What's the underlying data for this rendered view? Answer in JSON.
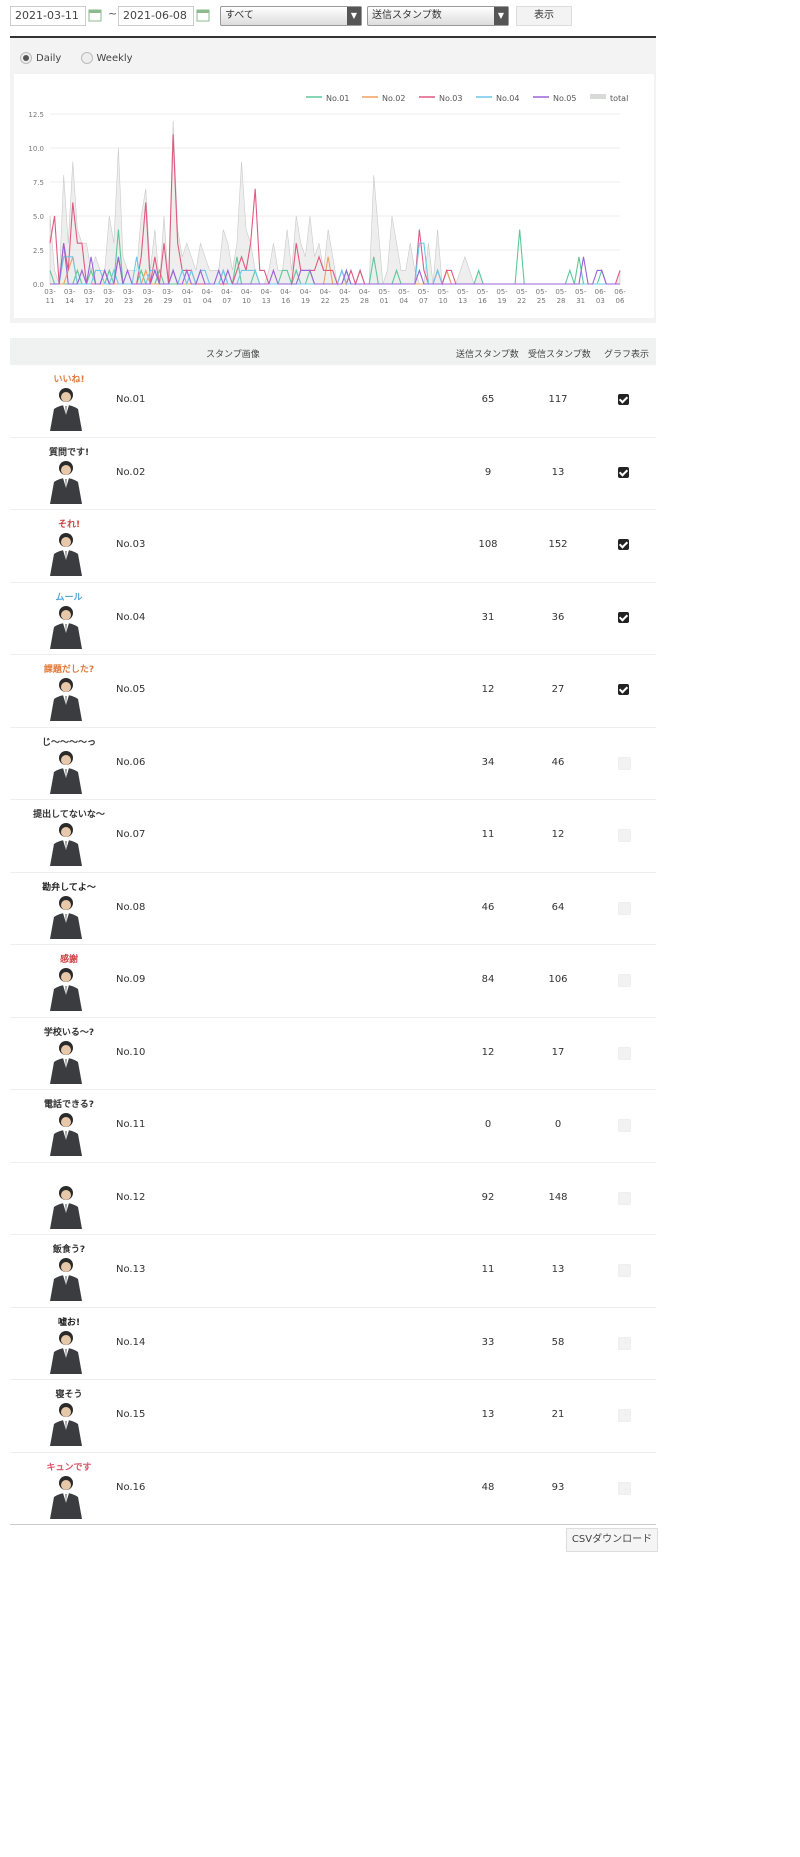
{
  "filter": {
    "start_date": "2021-03-11",
    "separator": "~",
    "end_date": "2021-06-08",
    "category_select": "すべて",
    "metric_select": "送信スタンプ数",
    "show_button": "表示"
  },
  "period": {
    "daily": "Daily",
    "weekly": "Weekly",
    "selected": "Daily"
  },
  "chart_data": {
    "type": "area",
    "title": "",
    "xlabel": "",
    "ylabel": "",
    "ylim": [
      0,
      12.5
    ],
    "yticks": [
      "0.0",
      "2.5",
      "5.0",
      "7.5",
      "10.0",
      "12.5"
    ],
    "tick_labels": [
      [
        "03-",
        "11"
      ],
      [
        "03-",
        "14"
      ],
      [
        "03-",
        "17"
      ],
      [
        "03-",
        "20"
      ],
      [
        "03-",
        "23"
      ],
      [
        "03-",
        "26"
      ],
      [
        "03-",
        "29"
      ],
      [
        "04-",
        "01"
      ],
      [
        "04-",
        "04"
      ],
      [
        "04-",
        "07"
      ],
      [
        "04-",
        "10"
      ],
      [
        "04-",
        "13"
      ],
      [
        "04-",
        "16"
      ],
      [
        "04-",
        "19"
      ],
      [
        "04-",
        "22"
      ],
      [
        "04-",
        "25"
      ],
      [
        "04-",
        "28"
      ],
      [
        "05-",
        "01"
      ],
      [
        "05-",
        "04"
      ],
      [
        "05-",
        "07"
      ],
      [
        "05-",
        "10"
      ],
      [
        "05-",
        "13"
      ],
      [
        "05-",
        "16"
      ],
      [
        "05-",
        "19"
      ],
      [
        "05-",
        "22"
      ],
      [
        "05-",
        "25"
      ],
      [
        "05-",
        "28"
      ],
      [
        "05-",
        "31"
      ],
      [
        "06-",
        "03"
      ],
      [
        "06-",
        "06"
      ]
    ],
    "legend_position": "top-right",
    "series": [
      {
        "name": "No.01",
        "color": "#5ec79a",
        "values": [
          1,
          0,
          0,
          0,
          0,
          0,
          1,
          0,
          0,
          1,
          0,
          0,
          0,
          1,
          0,
          4,
          0,
          0,
          0,
          0,
          1,
          0,
          0,
          0,
          1,
          0,
          0,
          0,
          0,
          0,
          0,
          0,
          0,
          0,
          0,
          0,
          0,
          0,
          1,
          0,
          0,
          2,
          0,
          0,
          0,
          1,
          0,
          0,
          0,
          0,
          0,
          1,
          1,
          0,
          1,
          0,
          0,
          1,
          0,
          0,
          0,
          0,
          0,
          0,
          0,
          1,
          0,
          0,
          1,
          0,
          0,
          2,
          0,
          0,
          0,
          0,
          1,
          0,
          0,
          0,
          0,
          0,
          0,
          0,
          0,
          0,
          0,
          1,
          0,
          0,
          0,
          0,
          0,
          0,
          1,
          0,
          0,
          0,
          0,
          0,
          0,
          0,
          0,
          4,
          0,
          0,
          0,
          0,
          0,
          0,
          0,
          0,
          0,
          0,
          1,
          0,
          2,
          0,
          0,
          0,
          0,
          1,
          0,
          0,
          0,
          0
        ]
      },
      {
        "name": "No.02",
        "color": "#f0a060",
        "values": [
          0,
          0,
          0,
          0,
          1,
          2,
          0,
          0,
          0,
          0,
          0,
          0,
          0,
          0,
          0,
          0,
          0,
          0,
          0,
          0,
          0,
          1,
          0,
          0,
          0,
          0,
          0,
          1,
          0,
          0,
          0,
          0,
          0,
          0,
          0,
          0,
          0,
          0,
          0,
          0,
          0,
          0,
          0,
          0,
          0,
          0,
          0,
          0,
          0,
          0,
          0,
          0,
          0,
          0,
          0,
          0,
          0,
          0,
          0,
          0,
          0,
          2,
          0,
          0,
          0,
          0,
          0,
          0,
          0,
          0,
          0,
          0,
          0,
          0,
          0,
          0,
          0,
          0,
          0,
          0,
          0,
          0,
          0,
          0,
          0,
          0,
          0,
          1,
          0,
          0,
          0,
          0,
          0,
          0,
          0,
          0,
          0,
          0,
          0,
          0,
          0,
          0,
          0,
          0,
          0,
          0,
          0,
          0,
          0,
          0,
          0,
          0,
          0,
          0,
          0,
          0,
          0,
          0,
          0,
          0,
          0,
          0,
          0,
          0,
          0,
          0
        ]
      },
      {
        "name": "No.03",
        "color": "#e05a82",
        "values": [
          3,
          5,
          0,
          3,
          1,
          6,
          3,
          3,
          0,
          0,
          0,
          0,
          1,
          0,
          0,
          2,
          0,
          0,
          0,
          0,
          2,
          6,
          0,
          2,
          0,
          3,
          0,
          11,
          3,
          1,
          1,
          1,
          0,
          0,
          0,
          0,
          0,
          0,
          0,
          0,
          0,
          1,
          2,
          1,
          3,
          7,
          1,
          1,
          0,
          0,
          0,
          0,
          0,
          0,
          3,
          1,
          1,
          1,
          1,
          2,
          1,
          1,
          1,
          0,
          1,
          0,
          1,
          0,
          1,
          0,
          0,
          0,
          0,
          0,
          0,
          0,
          0,
          0,
          0,
          0,
          0,
          4,
          1,
          0,
          0,
          1,
          0,
          1,
          1,
          0,
          0,
          0,
          0,
          0,
          0,
          0,
          0,
          0,
          0,
          0,
          0,
          0,
          0,
          0,
          0,
          0,
          0,
          0,
          0,
          0,
          0,
          0,
          0,
          0,
          0,
          0,
          0,
          0,
          0,
          0,
          0,
          0,
          0,
          0,
          0,
          1
        ]
      },
      {
        "name": "No.04",
        "color": "#6cc8e8",
        "values": [
          0,
          0,
          0,
          2,
          2,
          2,
          0,
          0,
          0,
          0,
          1,
          1,
          0,
          0,
          1,
          0,
          0,
          0,
          0,
          2,
          0,
          0,
          1,
          1,
          0,
          0,
          0,
          1,
          0,
          1,
          0,
          1,
          0,
          1,
          1,
          0,
          0,
          0,
          1,
          0,
          0,
          0,
          1,
          1,
          1,
          1,
          0,
          0,
          0,
          0,
          0,
          0,
          0,
          0,
          0,
          0,
          0,
          0,
          0,
          0,
          0,
          0,
          0,
          0,
          1,
          0,
          0,
          0,
          0,
          0,
          0,
          0,
          0,
          0,
          0,
          0,
          0,
          0,
          0,
          0,
          0,
          3,
          3,
          0,
          0,
          1,
          0,
          0,
          0,
          0,
          0,
          0,
          0,
          0,
          0,
          0,
          0,
          0,
          0,
          0,
          0,
          0,
          0,
          0,
          0,
          0,
          0,
          0,
          0,
          0,
          0,
          0,
          0,
          0,
          0,
          0,
          0,
          0,
          0,
          0,
          0,
          0,
          0,
          0,
          0,
          0
        ]
      },
      {
        "name": "No.05",
        "color": "#9a63d9",
        "values": [
          0,
          0,
          0,
          3,
          0,
          0,
          0,
          1,
          0,
          2,
          0,
          0,
          1,
          0,
          0,
          2,
          0,
          1,
          0,
          0,
          0,
          0,
          0,
          1,
          0,
          0,
          0,
          1,
          0,
          0,
          1,
          0,
          0,
          1,
          0,
          0,
          0,
          1,
          0,
          1,
          0,
          0,
          0,
          0,
          0,
          0,
          0,
          0,
          0,
          1,
          0,
          0,
          0,
          0,
          0,
          1,
          1,
          1,
          0,
          0,
          0,
          0,
          0,
          0,
          0,
          1,
          0,
          0,
          0,
          0,
          0,
          0,
          0,
          0,
          0,
          0,
          0,
          0,
          0,
          0,
          0,
          1,
          0,
          0,
          0,
          0,
          0,
          0,
          0,
          0,
          0,
          0,
          0,
          0,
          0,
          0,
          0,
          0,
          0,
          0,
          0,
          0,
          0,
          0,
          0,
          0,
          0,
          0,
          0,
          0,
          0,
          0,
          0,
          0,
          0,
          0,
          0,
          2,
          0,
          0,
          1,
          1,
          0,
          0,
          0,
          0
        ]
      },
      {
        "name": "total",
        "color": "#d8dad8",
        "values": [
          5,
          1,
          0,
          8,
          3,
          9,
          4,
          3,
          3,
          1,
          2,
          1,
          1,
          5,
          3,
          10,
          2,
          1,
          1,
          1,
          5,
          7,
          1,
          4,
          0,
          5,
          0,
          12,
          4,
          2,
          3,
          2,
          1,
          3,
          2,
          1,
          1,
          1,
          4,
          3,
          1,
          3,
          9,
          4,
          3,
          1,
          0,
          0,
          1,
          3,
          1,
          1,
          4,
          1,
          5,
          3,
          2,
          5,
          2,
          3,
          1,
          4,
          2,
          0,
          0,
          1,
          0,
          0,
          0,
          0,
          0,
          8,
          4,
          0,
          1,
          5,
          3,
          1,
          1,
          3,
          1,
          0,
          0,
          3,
          0,
          4,
          0,
          0,
          0,
          0,
          1,
          2,
          1,
          0,
          1,
          0,
          0,
          0,
          0,
          0,
          0,
          0,
          0,
          0,
          0,
          0,
          0,
          0,
          0,
          0,
          0,
          0,
          0,
          0,
          0,
          0,
          0,
          0,
          0,
          0,
          0,
          0,
          0,
          0,
          0,
          1
        ]
      }
    ]
  },
  "table": {
    "headers": {
      "image": "スタンプ画像",
      "sent": "送信スタンプ数",
      "received": "受信スタンプ数",
      "graph": "グラフ表示"
    },
    "rows": [
      {
        "name": "No.01",
        "sent": "65",
        "received": "117",
        "checked": true,
        "caption": "いいね!"
      },
      {
        "name": "No.02",
        "sent": "9",
        "received": "13",
        "checked": true,
        "caption": "質問です!"
      },
      {
        "name": "No.03",
        "sent": "108",
        "received": "152",
        "checked": true,
        "caption": "それ!"
      },
      {
        "name": "No.04",
        "sent": "31",
        "received": "36",
        "checked": true,
        "caption": "ムール"
      },
      {
        "name": "No.05",
        "sent": "12",
        "received": "27",
        "checked": true,
        "caption": "課題だした?"
      },
      {
        "name": "No.06",
        "sent": "34",
        "received": "46",
        "checked": false,
        "caption": "じ〜〜〜〜っ"
      },
      {
        "name": "No.07",
        "sent": "11",
        "received": "12",
        "checked": false,
        "caption": "提出してないな〜"
      },
      {
        "name": "No.08",
        "sent": "46",
        "received": "64",
        "checked": false,
        "caption": "勘弁してよ〜"
      },
      {
        "name": "No.09",
        "sent": "84",
        "received": "106",
        "checked": false,
        "caption": "感謝"
      },
      {
        "name": "No.10",
        "sent": "12",
        "received": "17",
        "checked": false,
        "caption": "学校いる〜?"
      },
      {
        "name": "No.11",
        "sent": "0",
        "received": "0",
        "checked": false,
        "caption": "電話できる?"
      },
      {
        "name": "No.12",
        "sent": "92",
        "received": "148",
        "checked": false,
        "caption": ""
      },
      {
        "name": "No.13",
        "sent": "11",
        "received": "13",
        "checked": false,
        "caption": "飯食う?"
      },
      {
        "name": "No.14",
        "sent": "33",
        "received": "58",
        "checked": false,
        "caption": "嘘お!"
      },
      {
        "name": "No.15",
        "sent": "13",
        "received": "21",
        "checked": false,
        "caption": "寝そう"
      },
      {
        "name": "No.16",
        "sent": "48",
        "received": "93",
        "checked": false,
        "caption": "キュンです"
      }
    ]
  },
  "csv_button": "CSVダウンロード"
}
